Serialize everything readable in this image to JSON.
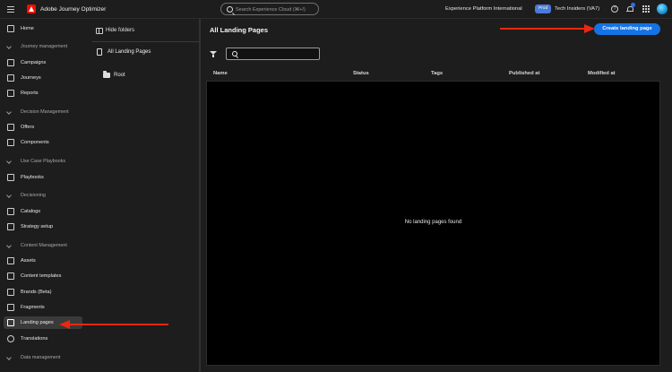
{
  "header": {
    "app_title": "Adobe Journey Optimizer",
    "search_placeholder": "Search Experience Cloud (⌘+/)",
    "org_name": "Experience Platform International",
    "env_badge": "Prod",
    "sandbox_name": "Tech Insiders (VA7)",
    "help_glyph": "?",
    "icons": [
      "menu-icon",
      "adobe-logo",
      "search-icon",
      "help-icon",
      "bell-icon",
      "apps-icon",
      "avatar"
    ]
  },
  "sidebar": {
    "items": [
      {
        "label": "Home",
        "icon": "home-icon"
      },
      {
        "label": "Journey management",
        "section": true
      },
      {
        "label": "Campaigns",
        "icon": "campaigns-icon"
      },
      {
        "label": "Journeys",
        "icon": "journeys-icon"
      },
      {
        "label": "Reports",
        "icon": "reports-icon"
      },
      {
        "label": "Decision Management",
        "section": true
      },
      {
        "label": "Offers",
        "icon": "offers-icon"
      },
      {
        "label": "Components",
        "icon": "components-icon"
      },
      {
        "label": "Use Case Playbooks",
        "section": true
      },
      {
        "label": "Playbooks",
        "icon": "playbooks-icon"
      },
      {
        "label": "Decisioning",
        "section": true
      },
      {
        "label": "Catalogs",
        "icon": "catalogs-icon"
      },
      {
        "label": "Strategy setup",
        "icon": "strategy-icon"
      },
      {
        "label": "Content Management",
        "section": true
      },
      {
        "label": "Assets",
        "icon": "assets-icon"
      },
      {
        "label": "Content templates",
        "icon": "templates-icon"
      },
      {
        "label": "Brands (Beta)",
        "icon": "brands-icon"
      },
      {
        "label": "Fragments",
        "icon": "fragments-icon"
      },
      {
        "label": "Landing pages",
        "icon": "landing-pages-icon",
        "active": true
      },
      {
        "label": "Translations",
        "icon": "translations-icon"
      },
      {
        "label": "Data management",
        "section": true
      }
    ]
  },
  "folders": {
    "hide_label": "Hide folders",
    "all_label": "All Landing Pages",
    "root_label": "Root"
  },
  "main": {
    "title": "All Landing Pages",
    "create_button": "Create landing page",
    "search_value": "",
    "columns": [
      "Name",
      "Status",
      "Tags",
      "Published at",
      "Modified at"
    ],
    "empty_message": "No landing pages found"
  },
  "colors": {
    "accent": "#1473e6",
    "annotation_arrow": "#e8280f",
    "background": "#1d1d1d"
  }
}
